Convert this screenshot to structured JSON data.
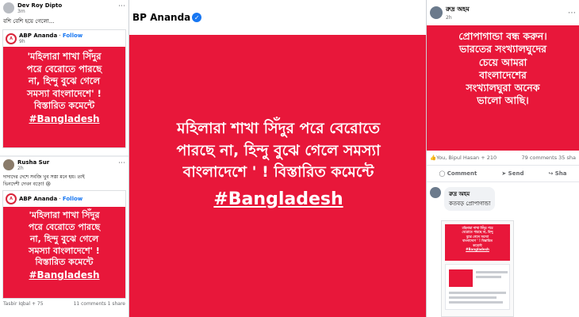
{
  "left_top": {
    "user_name": "Dev Roy Dipto",
    "time": "3m",
    "comment": "বশি বেশি হয়ে গেলো...",
    "page_name": "ABP Ananda",
    "follow": "Follow",
    "post_time": "9h",
    "post_lines": [
      "'মহিলারা শাখা সিঁদুর",
      "পরে বেরোতে পারছে",
      "না, হিন্দু বুঝে গেলে",
      "সমস্যা বাংলাদেশে' !",
      "বিস্তারিত কমেন্টে"
    ],
    "hashtag": "#Bangladesh"
  },
  "left_bottom": {
    "user_name": "Rusha Sur",
    "time": "2h",
    "comment_lines": [
      "দাদাদের দেশে সবজি খুব সস্তা মনে হয়। তাই",
      "ভিনদেশী দেখন বড়ো! 😢"
    ],
    "page_name": "ABP Ananda",
    "follow": "Follow",
    "post_lines": [
      "'মহিলারা শাখা সিঁদুর",
      "পরে বেরোতে পারছে",
      "না, হিন্দু বুঝে গেলে",
      "সমস্যা বাংলাদেশে' !",
      "বিস্তারিত কমেন্টে"
    ],
    "hashtag": "#Bangladesh",
    "reactions": "Tasbir Iqbal + 75",
    "counts": "11 comments  1 share"
  },
  "center": {
    "page_name": "BP Ananda",
    "post_lines": [
      "মহিলারা শাখা সিঁদুর পরে বেরোতে",
      "পারছে না, হিন্দু বুঝে গেলে সমস্যা",
      "বাংলাদেশে ' ! বিস্তারিত কমেন্টে"
    ],
    "hashtag": "#Bangladesh"
  },
  "right": {
    "user_name": "রুদ্র অহম",
    "time": "2h",
    "post_lines": [
      "প্রোপাগান্ডা বন্ধ করুন।",
      "ভারতের সংখ্যালঘুদের",
      "চেয়ে আমরা",
      "বাংলাদেশের",
      "সংখ্যালঘুরা অনেক",
      "ভালো আছি।"
    ],
    "reactions": "You, Bipul Hasan + 210",
    "comments": "79 comments",
    "shares": "35 sha",
    "actions": [
      "Comment",
      "Send",
      "Sha"
    ],
    "reply_name": "রুদ্র অহম",
    "reply_text": "কতবড় প্রোপাগান্ডা",
    "thumb_lines": [
      "মহিলারা শাখা সিঁদুর পরে",
      "বেরোতে পারছে না, হিন্দু",
      "বুঝে গেলে সমস্যা",
      "বাংলাদেশে ' ! বিস্তারিত",
      "কমেন্টে"
    ],
    "thumb_tag": "#Bangladesh"
  },
  "colors": {
    "post_red": "#e8173a",
    "link_blue": "#1877f2"
  }
}
